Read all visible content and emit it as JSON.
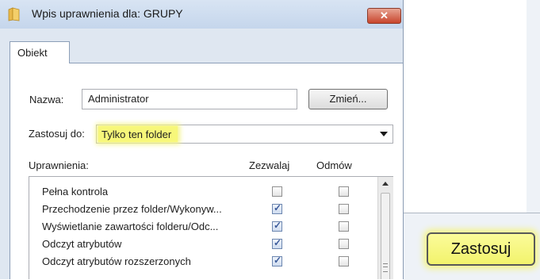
{
  "window": {
    "title": "Wpis uprawnienia dla: GRUPY",
    "close_label": "✕"
  },
  "tabs": [
    {
      "label": "Obiekt"
    }
  ],
  "name_row": {
    "label": "Nazwa:",
    "value": "Administrator",
    "change_button": "Zmień..."
  },
  "apply_row": {
    "label": "Zastosuj do:",
    "selected": "Tylko ten folder",
    "highlight_color": "#f7f77a"
  },
  "permissions": {
    "header": "Uprawnienia:",
    "col_allow": "Zezwalaj",
    "col_deny": "Odmów",
    "rows": [
      {
        "label": "Pełna kontrola",
        "allow": false,
        "deny": false
      },
      {
        "label": "Przechodzenie przez folder/Wykonyw...",
        "allow": true,
        "deny": false
      },
      {
        "label": "Wyświetlanie zawartości folderu/Odc...",
        "allow": true,
        "deny": false
      },
      {
        "label": "Odczyt atrybutów",
        "allow": true,
        "deny": false
      },
      {
        "label": "Odczyt atrybutów rozszerzonych",
        "allow": true,
        "deny": false
      }
    ]
  },
  "inset": {
    "apply_button": "Zastosuj"
  }
}
